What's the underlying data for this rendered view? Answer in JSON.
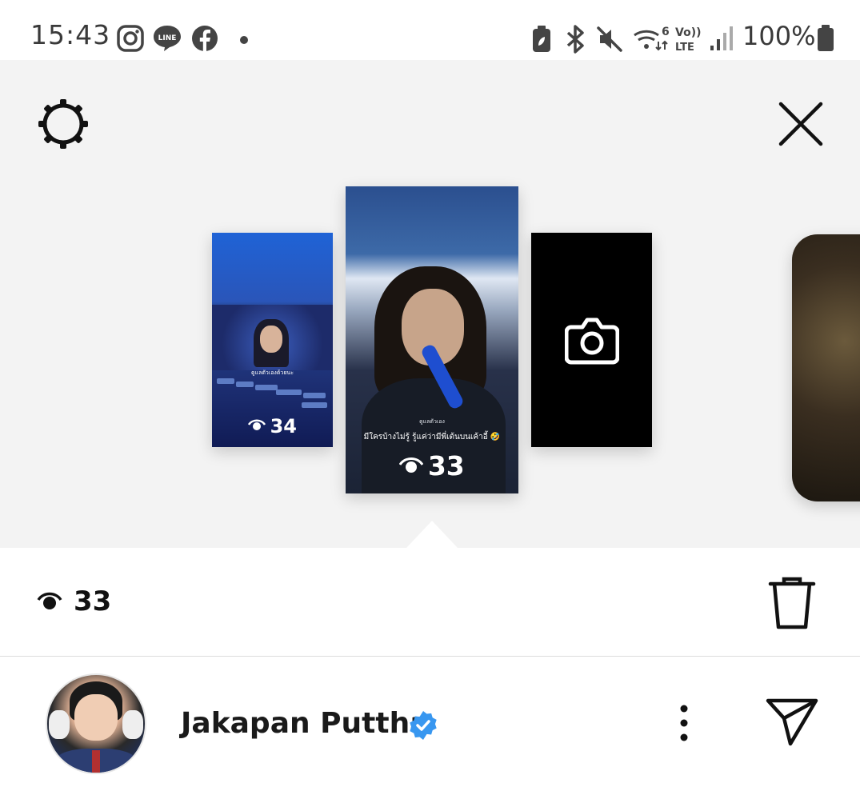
{
  "status_bar": {
    "time": "15:43",
    "notification_icons": [
      "instagram-icon",
      "line-icon",
      "facebook-icon",
      "dot-icon"
    ],
    "system_icons": [
      "battery-saver-icon",
      "bluetooth-icon",
      "mute-icon",
      "wifi-6-icon",
      "volte-icon",
      "signal-icon"
    ],
    "battery_percent": "100%"
  },
  "header": {
    "settings_icon": "gear-icon",
    "close_icon": "close-icon"
  },
  "stories": [
    {
      "views": "34",
      "caption": "ดูแลตัวเองด้วยนะ"
    },
    {
      "views": "33",
      "caption_small": "ดูแลตัวเอง",
      "caption": "มีใครบ้างไม่รู้ รู้แค่ว่ามีพี่เต้นบนเค้าอี้ 🤣"
    },
    {
      "type": "camera",
      "icon": "camera-icon"
    },
    {
      "type": "next-profile"
    }
  ],
  "selected_story": {
    "view_count": "33",
    "delete_icon": "trash-icon"
  },
  "user": {
    "name": "Jakapan Puttha",
    "verified": true,
    "more_icon": "more-vertical-icon",
    "share_icon": "send-icon"
  }
}
